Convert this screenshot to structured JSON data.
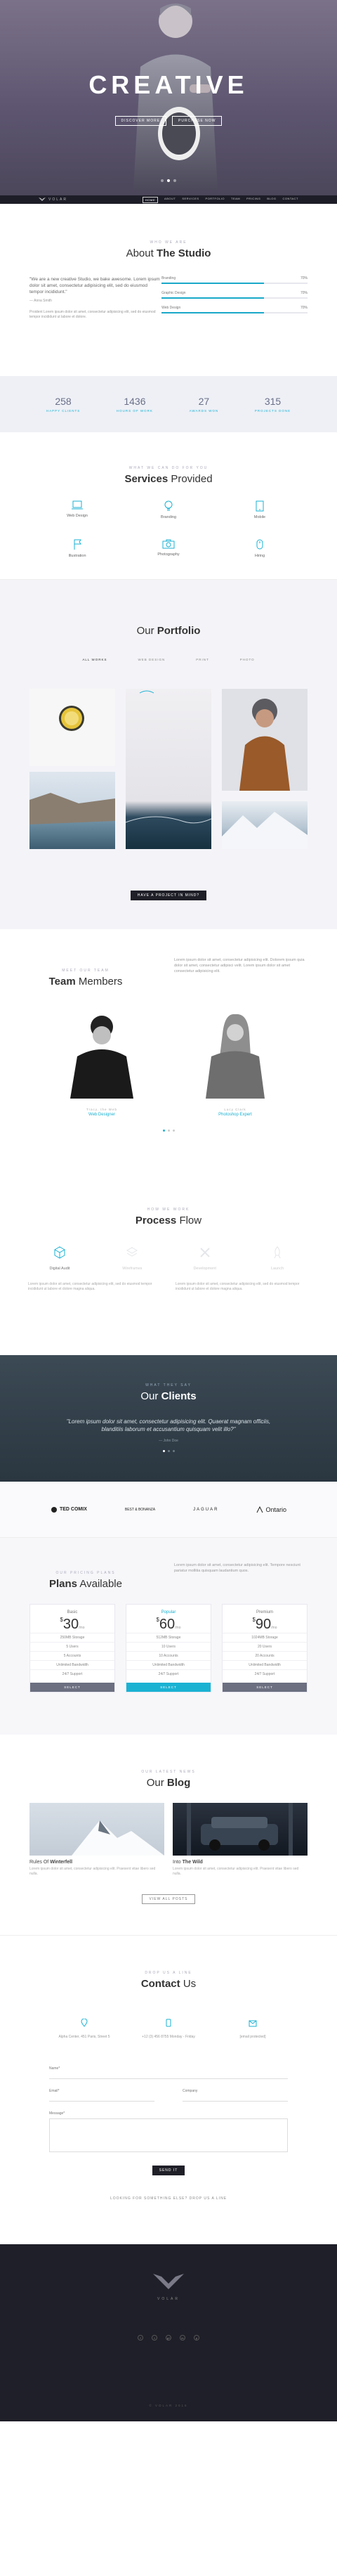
{
  "hero": {
    "title": "CREATIVE",
    "buttons": [
      "DISCOVER MORE",
      "PURCHASE NOW"
    ],
    "slides": 3,
    "active_slide": 1
  },
  "nav": {
    "logo": "VOLAR",
    "items": [
      "HOME",
      "ABOUT",
      "SERVICES",
      "PORTFOLIO",
      "TEAM",
      "PRICING",
      "BLOG",
      "CONTACT"
    ],
    "active": "HOME"
  },
  "about": {
    "kicker": "WHO WE ARE",
    "title_a": "About",
    "title_b": "The Studio",
    "quote": "\"We are a new creative Studio, we bake awesome. Lorem ipsum dolor sit amet, consectetur adipisicing elit, sed do eiusmod tempor incididunt.\"",
    "quote_author": "— Anna Smith",
    "body": "Proident Lorem ipsum dolor sit amet, consectetur adipisicing elit, sed do eiusmod tempor incididunt ut labore et dolore.",
    "skills": [
      {
        "name": "Branding",
        "value": "70%",
        "pct": 0.7
      },
      {
        "name": "Graphic Design",
        "value": "70%",
        "pct": 0.7
      },
      {
        "name": "Web Design",
        "value": "70%",
        "pct": 0.7
      }
    ]
  },
  "stats": [
    {
      "num": "258",
      "label": "Happy Clients"
    },
    {
      "num": "1436",
      "label": "Hours of Work"
    },
    {
      "num": "27",
      "label": "Awards Won"
    },
    {
      "num": "315",
      "label": "Projects Done"
    }
  ],
  "services": {
    "kicker": "WHAT WE CAN DO FOR YOU",
    "title_a": "Services",
    "title_b": "Provided",
    "items": [
      {
        "label": "Web Design",
        "icon": "laptop-icon"
      },
      {
        "label": "Branding",
        "icon": "lightbulb-icon"
      },
      {
        "label": "Mobile",
        "icon": "tablet-icon"
      },
      {
        "label": "Illustration",
        "icon": "flag-icon"
      },
      {
        "label": "Photography",
        "icon": "camera-icon"
      },
      {
        "label": "Hiring",
        "icon": "mouse-icon"
      }
    ]
  },
  "portfolio": {
    "title_a": "Our",
    "title_b": "Portfolio",
    "filters": [
      "ALL WORKS",
      "WEB DESIGN",
      "PRINT",
      "PHOTO"
    ],
    "active_filter": "ALL WORKS",
    "more_label": "HAVE A PROJECT IN MIND?"
  },
  "team": {
    "kicker": "MEET OUR TEAM",
    "title_a": "Team",
    "title_b": "Members",
    "body": "Lorem ipsum dolor sit amet, consectetur adipisicing elit. Dolorem ipsum quia dolor sit amet, consectetur adipisci velit. Lorem ipsum dolor sit amet consectetur adipisicing elit.",
    "members": [
      {
        "role": "Tracy, the Web",
        "name": "Web Designer"
      },
      {
        "role": "Lucy Clark",
        "name": "Photoshop Expert"
      }
    ]
  },
  "process": {
    "kicker": "HOW WE WORK",
    "title_a": "Process",
    "title_b": "Flow",
    "steps": [
      {
        "label": "Digital Audit",
        "icon": "cube-icon",
        "faded": false
      },
      {
        "label": "Wireframes",
        "icon": "layers-icon",
        "faded": true
      },
      {
        "label": "Development",
        "icon": "tools-icon",
        "faded": true
      },
      {
        "label": "Launch",
        "icon": "rocket-icon",
        "faded": true
      }
    ],
    "text_left": "Lorem ipsum dolor sit amet, consectetur adipisicing elit, sed do eiusmod tempor incididunt ut labore et dolore magna aliqua.",
    "text_right": "Lorem ipsum dolor sit amet, consectetur adipisicing elit, sed do eiusmod tempor incididunt ut labore et dolore magna aliqua."
  },
  "clients": {
    "kicker": "WHAT THEY SAY",
    "title_a": "Our",
    "title_b": "Clients",
    "quote": "\"Lorem ipsum dolor sit amet, consectetur adipisicing elit. Quaerat magnam officiis, blanditiis laborum et accusantium quisquam velit illo?\"",
    "author": "— John Doe"
  },
  "logos": [
    "TED COMIX",
    "BEST & BONANZA",
    "JAGUAR",
    "Ontario"
  ],
  "pricing": {
    "kicker": "OUR PRICING PLANS",
    "title_a": "Plans",
    "title_b": "Available",
    "body": "Lorem ipsum dolor sit amet, consectetur adipisicing elit. Tempore nesciunt pariatur mollitia quisquam laudantium quos.",
    "plans": [
      {
        "name": "Basic",
        "price": "30",
        "per": "/mo",
        "features": [
          "250MB Storage",
          "5 Users",
          "5 Accounts",
          "Unlimited Bandwidth",
          "24/7 Support"
        ],
        "button": "SELECT",
        "featured": false
      },
      {
        "name": "Popular",
        "price": "60",
        "per": "/mo",
        "features": [
          "512MB Storage",
          "10 Users",
          "10 Accounts",
          "Unlimited Bandwidth",
          "24/7 Support"
        ],
        "button": "SELECT",
        "featured": true
      },
      {
        "name": "Premium",
        "price": "90",
        "per": "/mo",
        "features": [
          "1024MB Storage",
          "20 Users",
          "20 Accounts",
          "Unlimited Bandwidth",
          "24/7 Support"
        ],
        "button": "SELECT",
        "featured": false
      }
    ]
  },
  "blog": {
    "kicker": "OUR LATEST NEWS",
    "title_a": "Our",
    "title_b": "Blog",
    "posts": [
      {
        "title_a": "Rules Of",
        "title_b": "Winterfell",
        "desc": "Lorem ipsum dolor sit amet, consectetur adipisicing elit. Praesent vitae libero sed nulla."
      },
      {
        "title_a": "Into",
        "title_b": "The Wild",
        "desc": "Lorem ipsum dolor sit amet, consectetur adipisicing elit. Praesent vitae libero sed nulla."
      }
    ],
    "more_label": "VIEW ALL POSTS"
  },
  "contact": {
    "kicker": "DROP US A LINE",
    "title_a": "Contact",
    "title_b": "Us",
    "info": [
      {
        "icon": "location-icon",
        "text": "Alpha Center, 451 Paris, Street 5"
      },
      {
        "icon": "phone-icon",
        "text": "+12 (3) 456 8755 Monday - Friday"
      },
      {
        "icon": "mail-icon",
        "text": "[email protected]"
      }
    ],
    "fields": {
      "name": "Name*",
      "email": "Email*",
      "company": "Company",
      "message": "Message*"
    },
    "send_label": "SEND IT",
    "note": "LOOKING FOR SOMETHING ELSE? DROP US A LINE"
  },
  "footer": {
    "name": "VOLAR",
    "social": [
      "f",
      "t",
      "g+",
      "in",
      "p"
    ],
    "copy": "© VOLAR 2016"
  },
  "colors": {
    "accent": "#1ab2d3",
    "dark": "#1f1f29"
  }
}
